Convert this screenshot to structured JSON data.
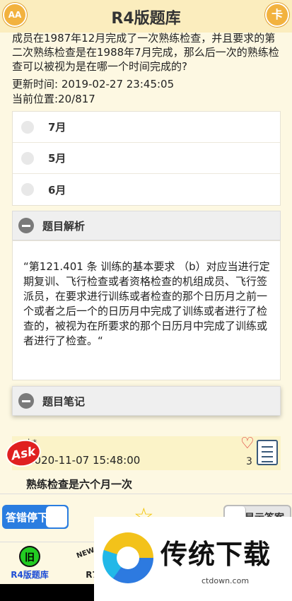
{
  "header": {
    "title": "R4版题库",
    "left_button": "AA",
    "right_button": "卡"
  },
  "question": {
    "text": "成员在1987年12月完成了一次熟练检查，并且要求的第二次熟练检查是在1988年7月完成，那么后一次的熟练检查可以被视为是在哪一个时间完成的?",
    "updated": "更新时间: 2019-02-27 23:45:05",
    "position": "当前位置:20/817"
  },
  "options": [
    {
      "label": "7月"
    },
    {
      "label": "5月"
    },
    {
      "label": "6月"
    }
  ],
  "analysis": {
    "title": "题目解析",
    "body": "“第121.401 条 训练的基本要求 （b）对应当进行定期复训、飞行检查或者资格检查的机组成员、飞行签派员，在要求进行训练或者检查的那个日历月之前一个或者之后一个的日历月中完成了训练或者进行了检查的，被视为在所要求的那个日历月中完成了训练或者进行了检查。“"
  },
  "notes": {
    "title": "题目笔记",
    "items": [
      {
        "user": "k*",
        "time": "2020-11-07 15:48:00",
        "text": "熟练检查是六个月一次",
        "likes": "3"
      }
    ]
  },
  "controls": {
    "stop_on_wrong": "答错停下",
    "show_answer": "显示答案",
    "stop_on_wrong_state": "on",
    "show_answer_state": "off"
  },
  "tabs": [
    {
      "icon": "旧",
      "label": "R4版题库"
    },
    {
      "icon": "NEW",
      "label": "R7版题"
    }
  ],
  "ad": {
    "title": "传统下载",
    "url": "ctdown.com",
    "badge": "Ask"
  },
  "colors": {
    "background": "#fdf8e2",
    "header": "#fbedbe",
    "accent": "#2a7de0",
    "star": "#f2c200",
    "tab_icon": "#22cc22"
  }
}
